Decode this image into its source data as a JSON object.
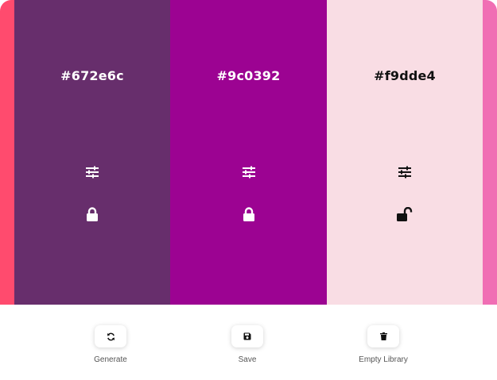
{
  "palette": {
    "edge_left_color": "#ff4b6e",
    "edge_right_color": "#f06eb4",
    "colors": [
      {
        "hex": "#672e6c",
        "text_color": "#ffffff",
        "locked": true
      },
      {
        "hex": "#9c0392",
        "text_color": "#ffffff",
        "locked": true
      },
      {
        "hex": "#f9dde4",
        "text_color": "#111111",
        "locked": false
      }
    ]
  },
  "controls": {
    "adjust_icon": "sliders-icon",
    "locked_icon": "lock-icon",
    "unlocked_icon": "unlock-icon"
  },
  "toolbar": {
    "generate_label": "Generate",
    "generate_icon": "refresh-icon",
    "save_label": "Save",
    "save_icon": "floppy-disk-icon",
    "empty_label": "Empty Library",
    "empty_icon": "trash-icon"
  }
}
